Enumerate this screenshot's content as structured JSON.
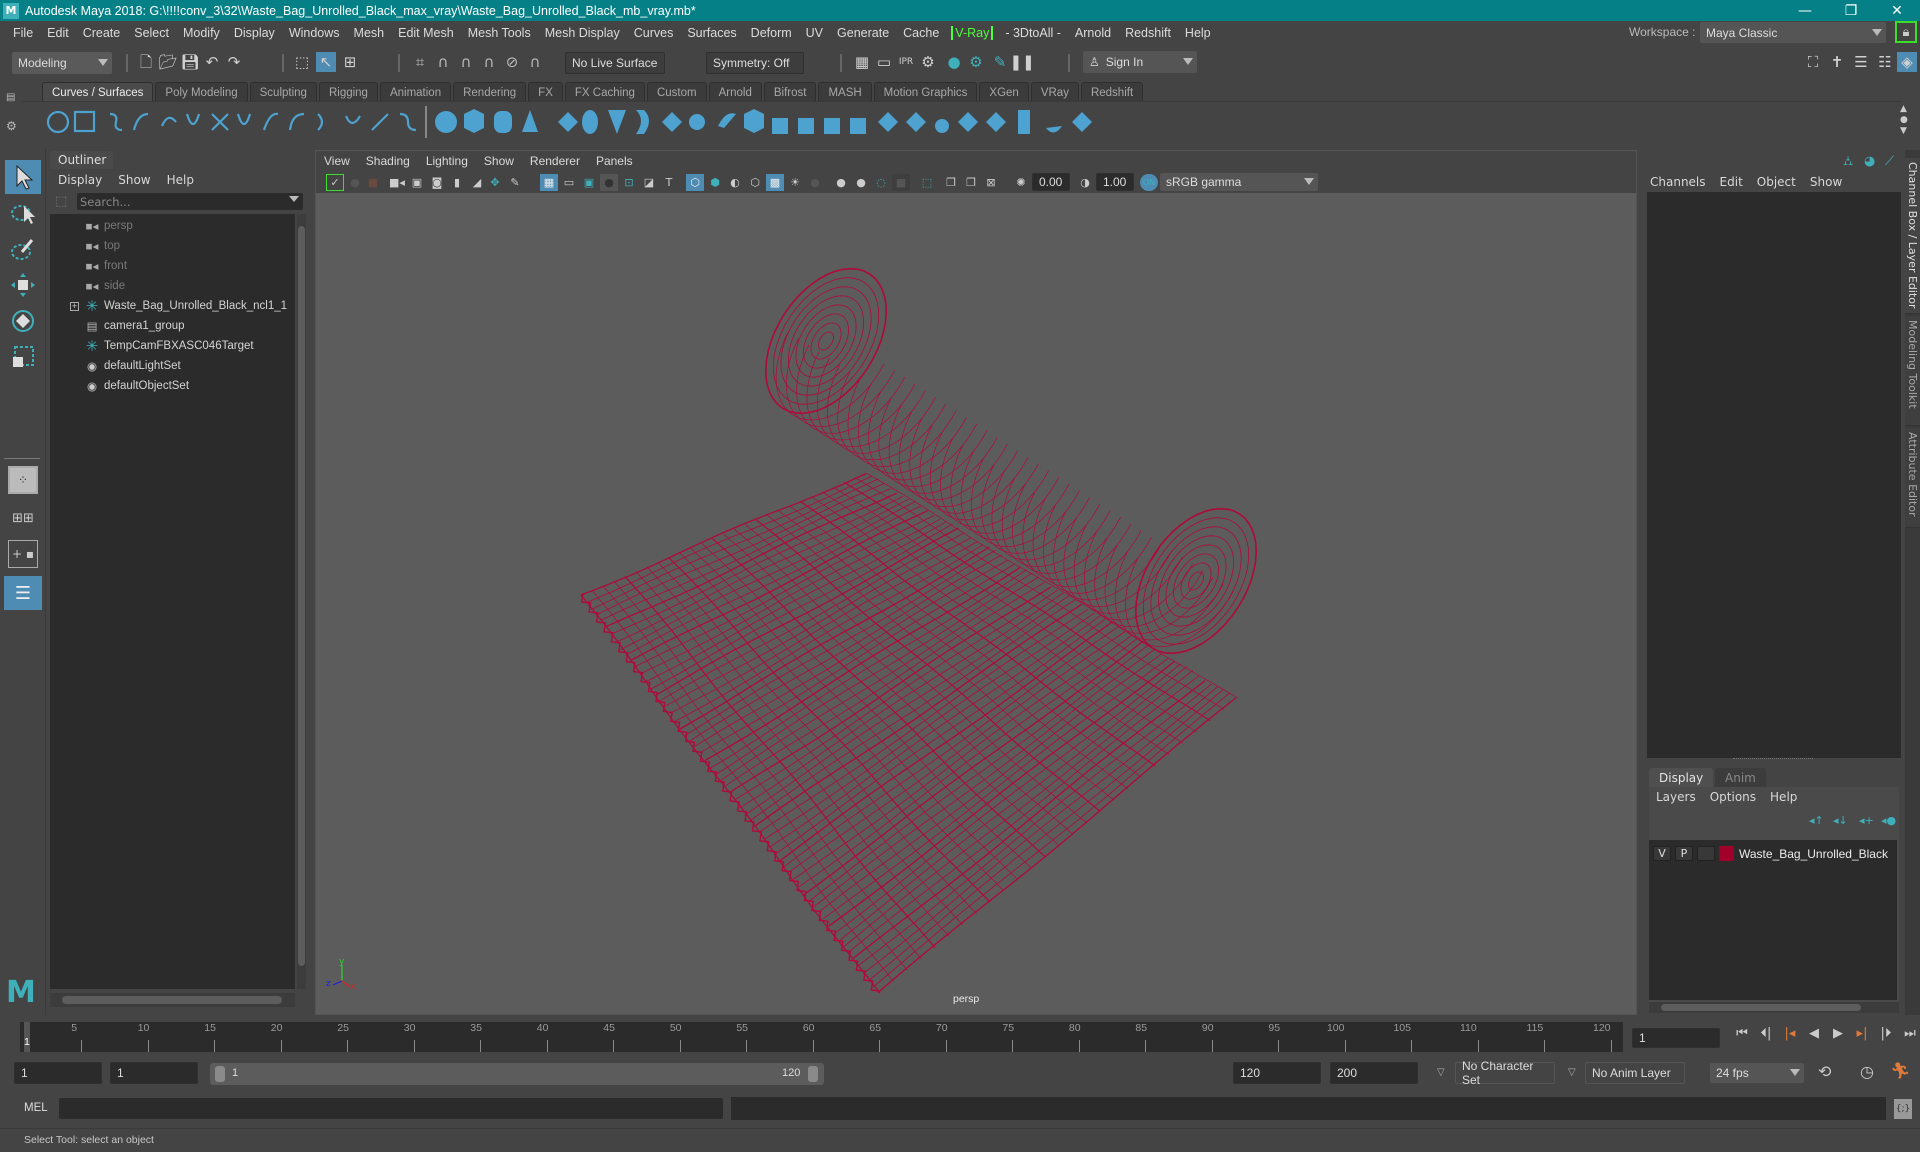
{
  "window": {
    "title": "Autodesk Maya 2018: G:\\!!!!conv_3\\32\\Waste_Bag_Unrolled_Black_max_vray\\Waste_Bag_Unrolled_Black_mb_vray.mb*",
    "logo": "M",
    "minimize": "—",
    "maximize": "❐",
    "close": "✕"
  },
  "menubar": {
    "items": [
      "File",
      "Edit",
      "Create",
      "Select",
      "Modify",
      "Display",
      "Windows",
      "Mesh",
      "Edit Mesh",
      "Mesh Tools",
      "Mesh Display",
      "Curves",
      "Surfaces",
      "Deform",
      "UV",
      "Generate",
      "Cache"
    ],
    "vray": "V-Ray",
    "items_after": [
      "- 3DtoAll -",
      "Arnold",
      "Redshift",
      "Help"
    ],
    "workspace_label": "Workspace :",
    "workspace_value": "Maya Classic"
  },
  "statusline": {
    "mode": "Modeling",
    "live_surface": "No Live Surface",
    "symmetry": "Symmetry: Off",
    "sign_in": "Sign In"
  },
  "shelf": {
    "tabs": [
      "Curves / Surfaces",
      "Poly Modeling",
      "Sculpting",
      "Rigging",
      "Animation",
      "Rendering",
      "FX",
      "FX Caching",
      "Custom",
      "Arnold",
      "Bifrost",
      "MASH",
      "Motion Graphics",
      "XGen",
      "VRay",
      "Redshift"
    ],
    "active_tab": "Curves / Surfaces"
  },
  "outliner": {
    "title": "Outliner",
    "menu": [
      "Display",
      "Show",
      "Help"
    ],
    "search_placeholder": "Search...",
    "items": [
      {
        "label": "persp",
        "icon": "camera-icon",
        "dim": true
      },
      {
        "label": "top",
        "icon": "camera-icon",
        "dim": true
      },
      {
        "label": "front",
        "icon": "camera-icon",
        "dim": true
      },
      {
        "label": "side",
        "icon": "camera-icon",
        "dim": true
      },
      {
        "label": "Waste_Bag_Unrolled_Black_ncl1_1",
        "icon": "locator-icon",
        "dim": false,
        "expandable": true
      },
      {
        "label": "camera1_group",
        "icon": "group-icon",
        "dim": false
      },
      {
        "label": "TempCamFBXASC046Target",
        "icon": "locator-icon",
        "dim": false
      },
      {
        "label": "defaultLightSet",
        "icon": "set-icon",
        "dim": false
      },
      {
        "label": "defaultObjectSet",
        "icon": "set-icon",
        "dim": false
      }
    ]
  },
  "viewport": {
    "menu": [
      "View",
      "Shading",
      "Lighting",
      "Show",
      "Renderer",
      "Panels"
    ],
    "exposure": "0.00",
    "gamma": "1.00",
    "color_space": "sRGB gamma",
    "camera_label": "persp",
    "wire_color": "#b0093a",
    "axis": {
      "x": "x",
      "y": "y",
      "z": "z"
    }
  },
  "channelbox": {
    "menu": [
      "Channels",
      "Edit",
      "Object",
      "Show"
    ],
    "side_tabs": [
      "Channel Box / Layer Editor",
      "Modeling Toolkit",
      "Attribute Editor"
    ]
  },
  "layers": {
    "tabs": [
      "Display",
      "Anim"
    ],
    "menu": [
      "Layers",
      "Options",
      "Help"
    ],
    "layer": {
      "v": "V",
      "p": "P",
      "name": "Waste_Bag_Unrolled_Black",
      "color": "#a0002a"
    }
  },
  "timeline": {
    "start": 1,
    "end": 120,
    "current_frame": "1",
    "ticks": [
      5,
      10,
      15,
      20,
      25,
      30,
      35,
      40,
      45,
      50,
      55,
      60,
      65,
      70,
      75,
      80,
      85,
      90,
      95,
      100,
      105,
      110,
      115,
      120
    ],
    "current_label": "1"
  },
  "range": {
    "start_field": "1",
    "anim_start_field": "1",
    "slider_start": "1",
    "slider_end": "120",
    "end_field": "120",
    "anim_end_field": "200",
    "character_set": "No Character Set",
    "anim_layer": "No Anim Layer",
    "fps": "24 fps"
  },
  "command": {
    "lang": "MEL",
    "help": "Select Tool: select an object"
  }
}
